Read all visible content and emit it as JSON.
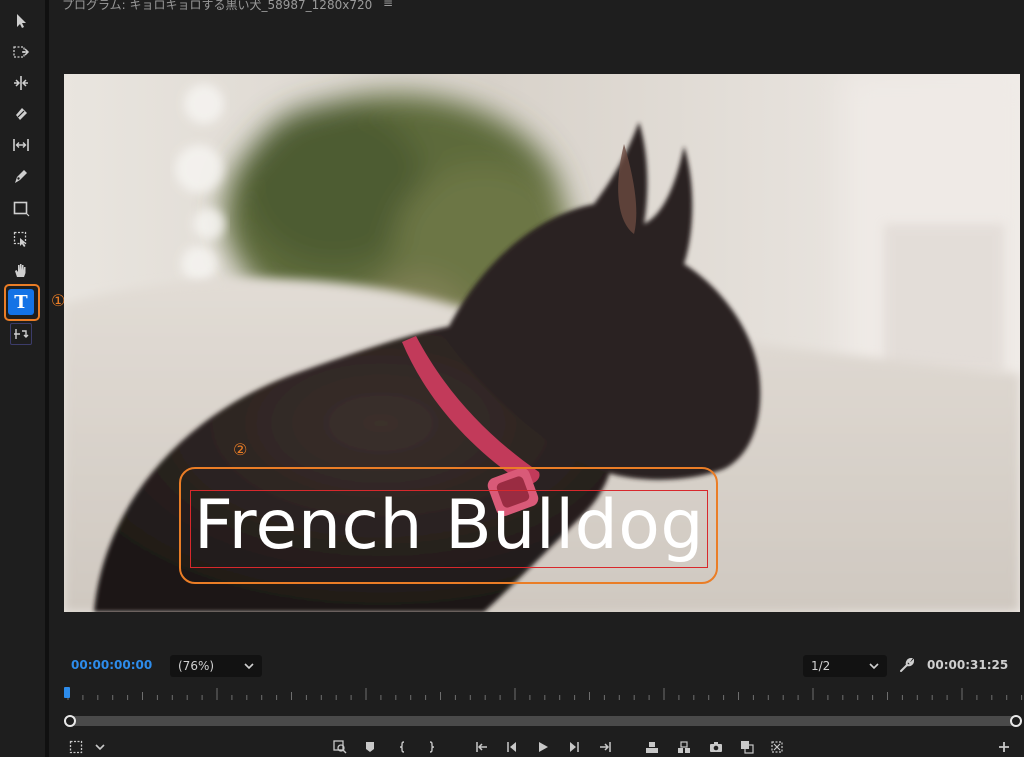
{
  "panel": {
    "title": "プログラム: キョロキョロする黒い犬_58987_1280x720",
    "menu_glyph": "≡"
  },
  "tools": [
    {
      "name": "selection-tool",
      "icon": "arrow-icon"
    },
    {
      "name": "track-select-tool",
      "icon": "track-select-icon"
    },
    {
      "name": "ripple-edit-tool",
      "icon": "ripple-icon"
    },
    {
      "name": "razor-tool",
      "icon": "razor-icon"
    },
    {
      "name": "slip-tool",
      "icon": "slip-icon"
    },
    {
      "name": "pen-tool",
      "icon": "pen-icon"
    },
    {
      "name": "rectangle-tool",
      "icon": "rectangle-icon"
    },
    {
      "name": "selection-frame-tool",
      "icon": "frame-icon"
    },
    {
      "name": "hand-tool",
      "icon": "hand-icon"
    },
    {
      "name": "type-tool",
      "icon": "type-icon",
      "label": "T",
      "active": true
    },
    {
      "name": "remix-tool",
      "icon": "remix-icon"
    }
  ],
  "annotations": {
    "callout_1": "①",
    "callout_2": "②",
    "accent": "#ea7d26"
  },
  "viewer": {
    "overlay_text": "French Bulldog"
  },
  "controls": {
    "timecode_current": "00:00:00:00",
    "zoom_level": "(76%)",
    "resolution": "1/2",
    "timecode_duration": "00:00:31:25"
  },
  "colors": {
    "accent_blue": "#2d8ceb",
    "active_tool": "#1473e6",
    "text_box_border": "#d8282c"
  }
}
